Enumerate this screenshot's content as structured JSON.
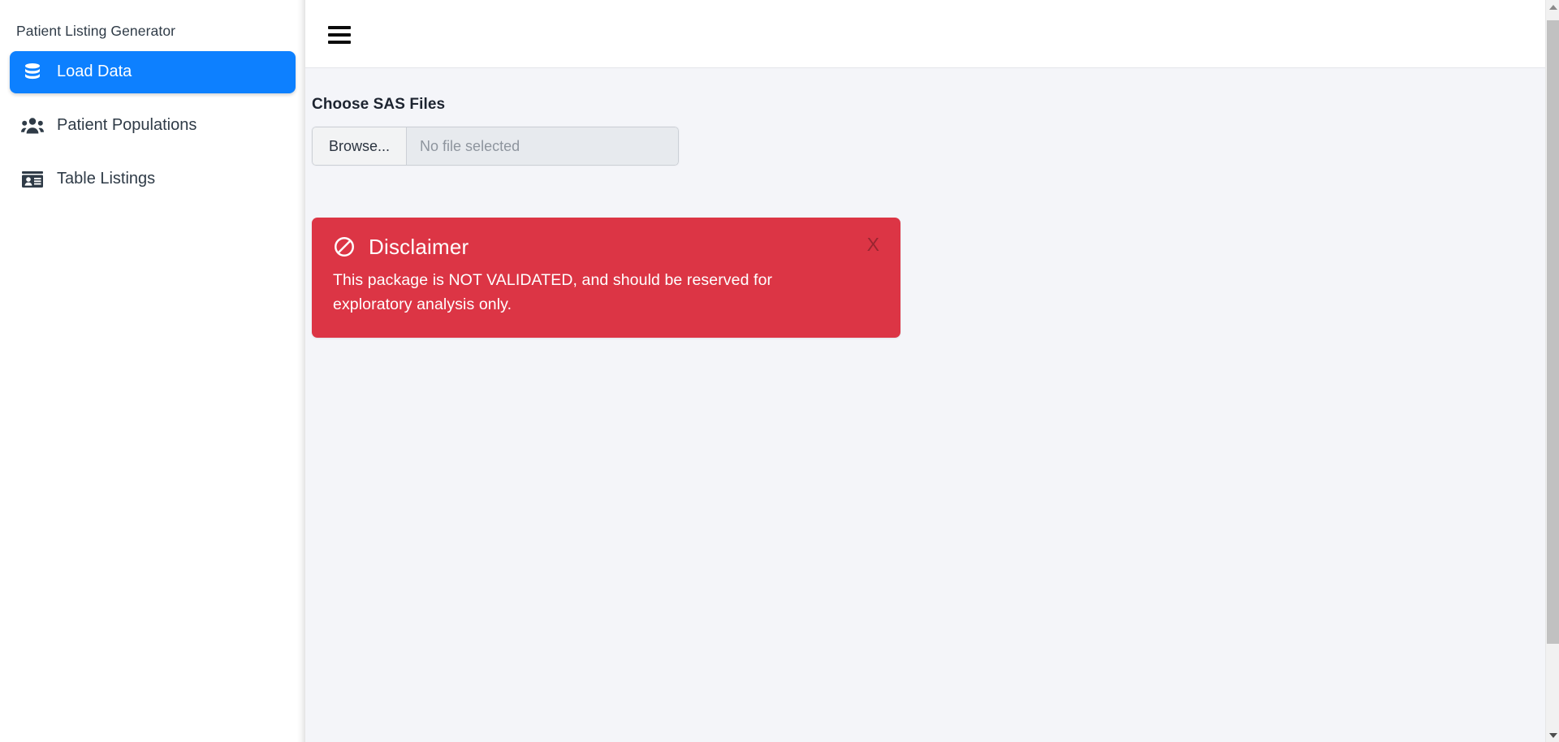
{
  "sidebar": {
    "title": "Patient Listing Generator",
    "items": [
      {
        "label": "Load Data",
        "icon": "database-icon",
        "active": true
      },
      {
        "label": "Patient Populations",
        "icon": "users-icon",
        "active": false
      },
      {
        "label": "Table Listings",
        "icon": "id-card-icon",
        "active": false
      }
    ]
  },
  "topbar": {
    "menu_icon": "hamburger-menu-icon"
  },
  "main": {
    "file_field": {
      "label": "Choose SAS Files",
      "browse_label": "Browse...",
      "file_placeholder": "No file selected",
      "value": ""
    },
    "alert": {
      "icon": "ban-icon",
      "title": "Disclaimer",
      "message": "This package is NOT VALIDATED, and should be reserved for exploratory analysis only.",
      "close_label": "X",
      "color": "#dc3545"
    }
  },
  "scrollbar": {
    "up_arrow": "caret-up-icon",
    "down_arrow": "caret-down-icon"
  },
  "colors": {
    "accent": "#0d80ff",
    "danger": "#dc3545",
    "content_bg": "#f4f5f9",
    "sidebar_bg": "#ffffff"
  }
}
